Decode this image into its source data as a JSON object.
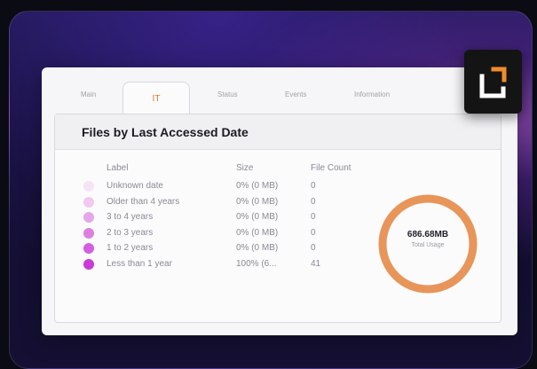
{
  "tabs": [
    "Main",
    "IT",
    "Status",
    "Events",
    "Information"
  ],
  "active_tab": "IT",
  "panel": {
    "title": "Files by Last Accessed Date"
  },
  "table": {
    "headers": {
      "label": "Label",
      "size": "Size",
      "count": "File Count"
    },
    "rows": [
      {
        "label": "Unknown date",
        "size": "0% (0 MB)",
        "count": "0",
        "color": "#f6e3f6"
      },
      {
        "label": "Older than 4 years",
        "size": "0% (0 MB)",
        "count": "0",
        "color": "#f0c8f0"
      },
      {
        "label": "3 to 4 years",
        "size": "0% (0 MB)",
        "count": "0",
        "color": "#e6a6ea"
      },
      {
        "label": "2 to 3 years",
        "size": "0% (0 MB)",
        "count": "0",
        "color": "#dc80e2"
      },
      {
        "label": "1 to 2 years",
        "size": "0% (0 MB)",
        "count": "0",
        "color": "#d35ee0"
      },
      {
        "label": "Less than 1 year",
        "size": "100% (6...",
        "count": "41",
        "color": "#c93bd6"
      }
    ]
  },
  "usage": {
    "value": "686.68MB",
    "label": "Total Usage",
    "ring_color": "#e8955a"
  },
  "logo": {
    "icon": "corner-bracket-logo-icon",
    "accent": "#f08c2a"
  }
}
